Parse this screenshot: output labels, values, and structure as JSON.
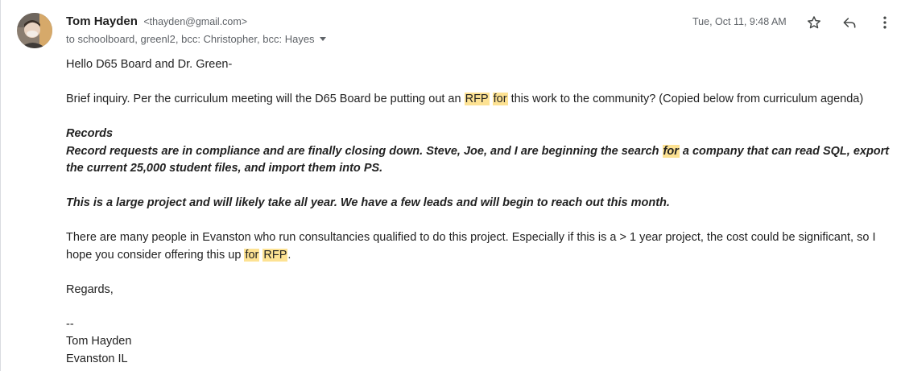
{
  "sender": {
    "name": "Tom Hayden",
    "email": "<thayden@gmail.com>"
  },
  "recipients": "to schoolboard, greenl2, bcc: Christopher, bcc: Hayes",
  "date": "Tue, Oct 11, 9:48 AM",
  "icons": {
    "star": "star-icon",
    "reply": "reply-icon",
    "more": "more-vert-icon",
    "caret": "chevron-down-icon"
  },
  "colors": {
    "highlight": "#fde293",
    "meta_text": "#5f6368",
    "body_text": "#222222"
  },
  "body": {
    "greeting": "Hello D65 Board and Dr. Green-",
    "p1": {
      "a": "Brief inquiry. Per the curriculum meeting will the D65 Board be putting out an ",
      "hl1": "RFP",
      "hl2": "for",
      "b": " this work to the community? (Copied below from curriculum agenda)"
    },
    "records_heading": "Records",
    "records_p": {
      "a": "Record requests are in compliance and are finally closing down. Steve, Joe, and I are beginning the search ",
      "hl": "for",
      "b": " a company that can read SQL, export the current 25,000 student files, and import them into PS."
    },
    "large_project": "This is a large project and will likely take all year. We have a few leads and will begin to reach out this month.",
    "p3": {
      "a": "There are many people in Evanston who run consultancies qualified to do this project. Especially if this is a > 1 year project, the cost could be significant, so I hope you consider offering this up ",
      "hl1": "for",
      "hl2": "RFP",
      "b": "."
    },
    "closing": "Regards,",
    "sig_dash": "--",
    "sig_name": "Tom Hayden",
    "sig_location": "Evanston IL"
  }
}
